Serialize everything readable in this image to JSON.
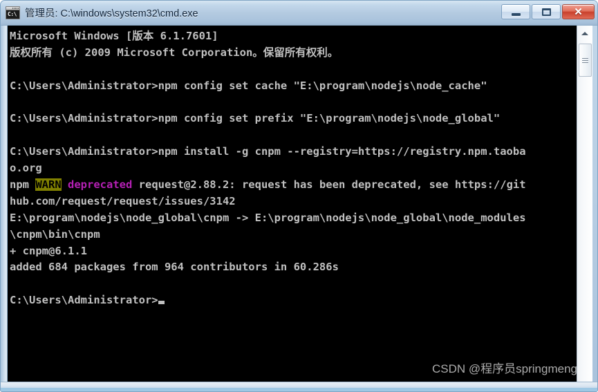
{
  "window": {
    "title": "管理员: C:\\windows\\system32\\cmd.exe",
    "icon_name": "cmd-console-icon",
    "icon_glyph": "C:\\",
    "buttons": {
      "minimize_label": "—",
      "maximize_label": "□",
      "close_label": "✕"
    },
    "colors": {
      "titlebar_top": "#d7e6f3",
      "titlebar_bottom": "#9fb9d4",
      "close_button": "#c8402c",
      "console_background": "#000000",
      "console_foreground": "#c0c0c0",
      "warn_background": "#808000",
      "deprecated_text": "#b520b5"
    }
  },
  "console": {
    "lines": [
      {
        "text": "Microsoft Windows [版本 6.1.7601]"
      },
      {
        "text": "版权所有 (c) 2009 Microsoft Corporation。保留所有权利。"
      },
      {
        "text": ""
      },
      {
        "text": "C:\\Users\\Administrator>npm config set cache \"E:\\program\\nodejs\\node_cache\""
      },
      {
        "text": ""
      },
      {
        "text": "C:\\Users\\Administrator>npm config set prefix \"E:\\program\\nodejs\\node_global\""
      },
      {
        "text": ""
      },
      {
        "text": "C:\\Users\\Administrator>npm install -g cnpm --registry=https://registry.npm.taoba"
      },
      {
        "text": "o.org"
      },
      {
        "warn": true,
        "prefix": "npm ",
        "badge": "WARN",
        "mid": " ",
        "magenta": "deprecated",
        "suffix": " request@2.88.2: request has been deprecated, see https://git"
      },
      {
        "text": "hub.com/request/request/issues/3142"
      },
      {
        "text": "E:\\program\\nodejs\\node_global\\cnpm -> E:\\program\\nodejs\\node_global\\node_modules"
      },
      {
        "text": "\\cnpm\\bin\\cnpm"
      },
      {
        "text": "+ cnpm@6.1.1"
      },
      {
        "text": "added 684 packages from 964 contributors in 60.286s"
      },
      {
        "text": ""
      },
      {
        "cursor": true,
        "text": "C:\\Users\\Administrator>"
      }
    ]
  },
  "scrollbar": {
    "up_arrow_name": "scroll-up-arrow",
    "thumb_name": "scroll-thumb"
  },
  "watermark": {
    "text": "CSDN @程序员springmeng"
  }
}
